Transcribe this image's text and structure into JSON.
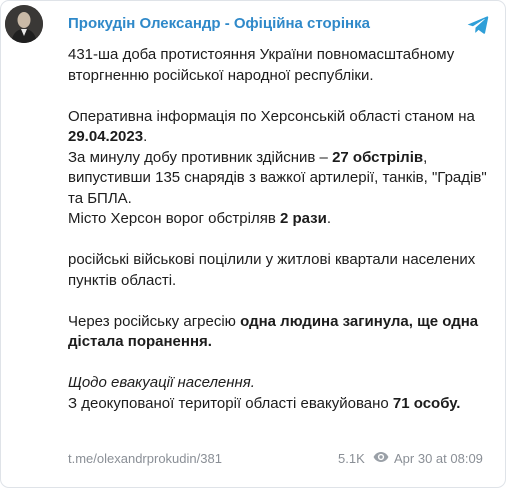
{
  "channel": {
    "name": "Прокудін Олександр - Офіційна сторінка"
  },
  "icons": {
    "avatar": "channel-avatar",
    "telegram": "telegram-logo-icon",
    "views": "eye-icon"
  },
  "colors": {
    "accent": "#2f89c9",
    "muted": "#8a8f96",
    "text": "#1c1c1c"
  },
  "message": {
    "p1": "431-ша доба протистояння України повномасштабному вторгненню російської народної республіки.",
    "p2_a": "Оперативна інформація по Херсонській області станом на ",
    "p2_b": "29.04.2023",
    "p2_c": ".",
    "p2_d": "За минулу добу противник здійснив – ",
    "p2_e": "27 обстрілів",
    "p2_f": ", випустивши 135 снарядів з важкої артилерії, танків, \"Градів\" та БПЛА.",
    "p2_g": "Місто Херсон ворог обстріляв ",
    "p2_h": "2 рази",
    "p2_i": ".",
    "p3": "російські військові поцілили у житлові квартали населених пунктів області.",
    "p4_a": "Через російську агресію ",
    "p4_b": "одна людина загинула, ще одна дістала поранення.",
    "p5_a": "Щодо евакуації населення.",
    "p5_b": "З деокупованої території області евакуйовано ",
    "p5_c": "71 особу."
  },
  "footer": {
    "link": "t.me/olexandrprokudin/381",
    "views": "5.1K",
    "date": "Apr 30 at 08:09"
  }
}
